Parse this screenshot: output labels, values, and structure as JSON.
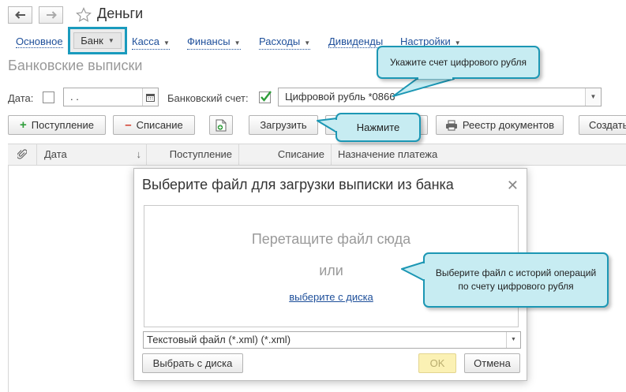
{
  "window": {
    "title": "Деньги"
  },
  "menu": {
    "items": [
      {
        "label": "Основное",
        "dropdown": false
      },
      {
        "label": "Банк",
        "dropdown": true
      },
      {
        "label": "Касса",
        "dropdown": true
      },
      {
        "label": "Финансы",
        "dropdown": true
      },
      {
        "label": "Расходы",
        "dropdown": true
      },
      {
        "label": "Дивиденды",
        "dropdown": false
      },
      {
        "label": "Настройки",
        "dropdown": true
      }
    ],
    "active": "Банк"
  },
  "section_title": "Банковские выписки",
  "filters": {
    "date_label": "Дата:",
    "date_value": ". .",
    "date_checked": false,
    "account_label": "Банковский счет:",
    "account_checked": true,
    "account_value": "Цифровой рубль *0866"
  },
  "toolbar": {
    "income_label": "Поступление",
    "expense_label": "Списание",
    "load_label": "Загрузить",
    "registry_label": "Реестр документов",
    "create_label": "Создать"
  },
  "table": {
    "columns": [
      "Дата",
      "Поступление",
      "Списание",
      "Назначение платежа"
    ]
  },
  "dialog": {
    "title": "Выберите файл для загрузки выписки из банка",
    "drop_text": "Перетащите файл сюда",
    "or_text": "или",
    "choose_link": "выберите с диска",
    "file_type": "Текстовый файл (*.xml) (*.xml)",
    "choose_button": "Выбрать с диска",
    "ok_button": "OK",
    "cancel_button": "Отмена"
  },
  "callouts": {
    "account_hint": "Укажите счет цифрового рубля",
    "press_hint": "Нажмите",
    "file_hint_line1": "Выберите файл с историй операций",
    "file_hint_line2": "по счету цифрового рубля"
  },
  "colors": {
    "accent": "#1a9bbd",
    "callout_bg": "#c7ecf2",
    "link": "#1e4f9a",
    "ok_bg": "#fbf1b4",
    "check": "#2e9d3a"
  }
}
